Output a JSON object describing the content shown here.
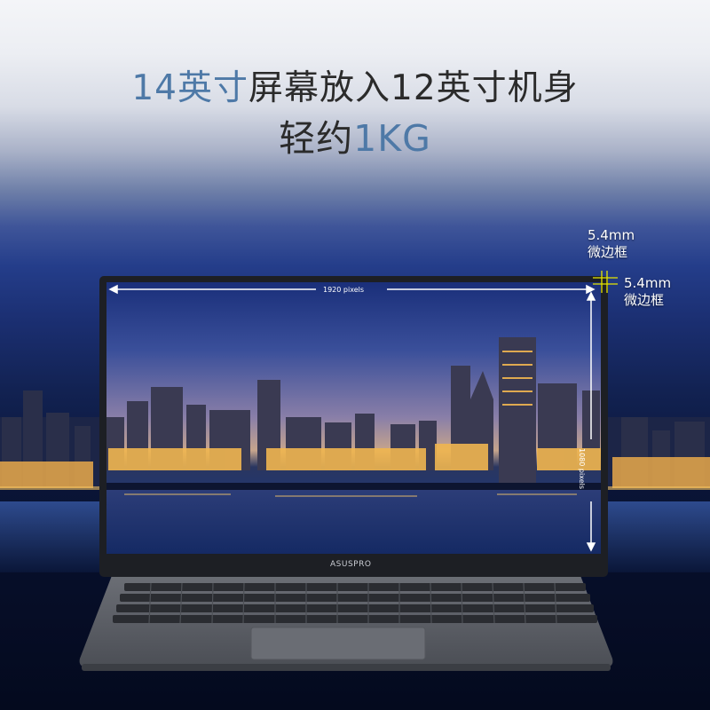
{
  "headline": {
    "line1_accent": "14英寸",
    "line1_rest": "屏幕放入12英寸机身",
    "line2_prefix": "轻约",
    "line2_accent": "1KG"
  },
  "bezel_callouts": {
    "top": {
      "size": "5.4mm",
      "label": "微边框"
    },
    "side": {
      "size": "5.4mm",
      "label": "微边框"
    }
  },
  "screen": {
    "width_label": "1920 pixels",
    "height_label": "1080 pixels"
  },
  "brand": "ASUSPRO",
  "colors": {
    "accent": "#4e79a7",
    "marker": "#e6e600",
    "laptop_body": "#5f6268"
  }
}
